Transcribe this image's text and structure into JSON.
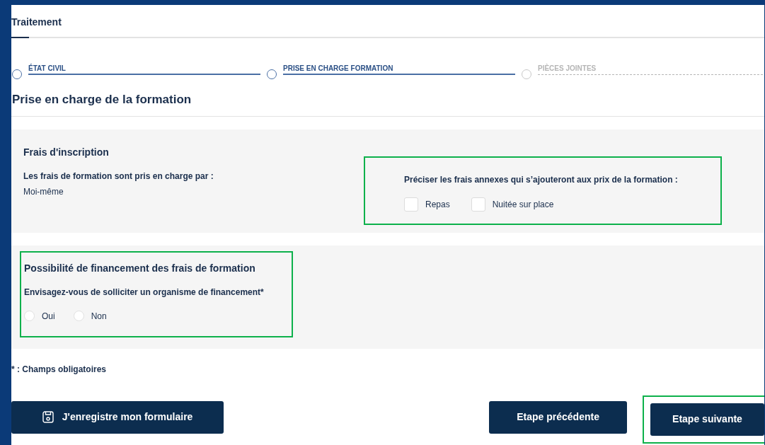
{
  "tabs": [
    {
      "label": "Traitement",
      "selected": true
    }
  ],
  "steps": [
    {
      "label": "ÉTAT CIVIL",
      "enabled": true
    },
    {
      "label": "PRISE EN CHARGE FORMATION",
      "enabled": true
    },
    {
      "label": "PIÈCES JOINTES",
      "enabled": false
    }
  ],
  "page_title": "Prise en charge de la formation",
  "fees_section": {
    "title": "Frais d'inscription",
    "paid_by_label": "Les frais de formation sont pris en charge par :",
    "paid_by_value": "Moi-même",
    "extras": {
      "highlighted": true,
      "label": "Préciser les frais annexes qui s’ajouteront aux prix de la formation :",
      "options": [
        {
          "label": "Repas",
          "checked": false
        },
        {
          "label": "Nuitée sur place",
          "checked": false
        }
      ]
    }
  },
  "funding_section": {
    "highlighted": true,
    "title": "Possibilité de financement des frais de formation",
    "question": "Envisagez-vous de solliciter un organisme de financement*",
    "options": [
      {
        "label": "Oui",
        "selected": false
      },
      {
        "label": "Non",
        "selected": false
      }
    ]
  },
  "required_note": "* : Champs obligatoires",
  "buttons": [
    {
      "kind": "save",
      "label": "J'enregistre mon formulaire"
    },
    {
      "kind": "previous",
      "label": "Etape précédente"
    },
    {
      "kind": "next",
      "label": "Etape suivante",
      "highlighted": true
    }
  ]
}
